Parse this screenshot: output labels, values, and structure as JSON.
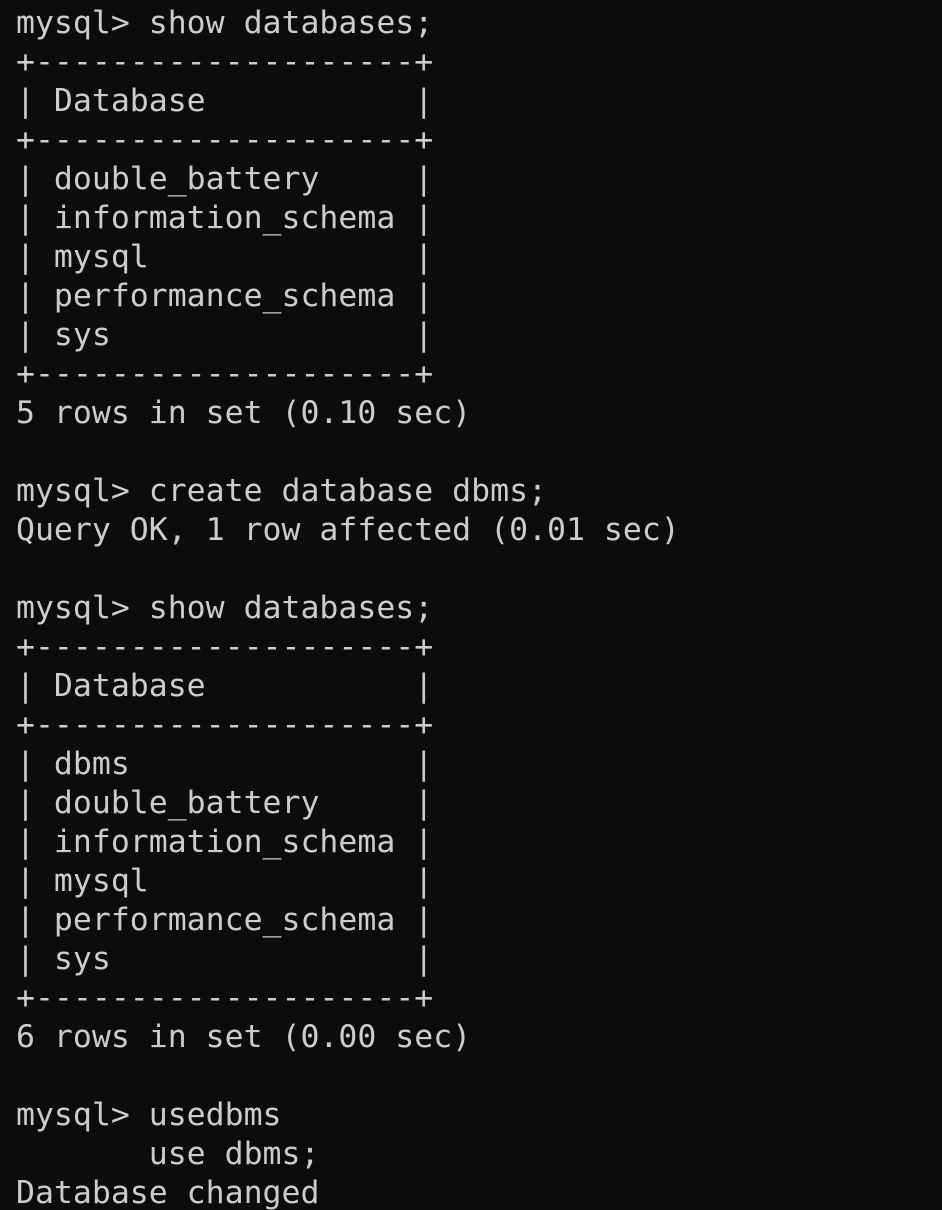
{
  "terminal": {
    "lines": [
      "mysql> show databases;",
      "+--------------------+",
      "| Database           |",
      "+--------------------+",
      "| double_battery     |",
      "| information_schema |",
      "| mysql              |",
      "| performance_schema |",
      "| sys                |",
      "+--------------------+",
      "5 rows in set (0.10 sec)",
      "",
      "mysql> create database dbms;",
      "Query OK, 1 row affected (0.01 sec)",
      "",
      "mysql> show databases;",
      "+--------------------+",
      "| Database           |",
      "+--------------------+",
      "| dbms               |",
      "| double_battery     |",
      "| information_schema |",
      "| mysql              |",
      "| performance_schema |",
      "| sys                |",
      "+--------------------+",
      "6 rows in set (0.00 sec)",
      "",
      "mysql> usedbms",
      "       use dbms;",
      "Database changed"
    ]
  }
}
